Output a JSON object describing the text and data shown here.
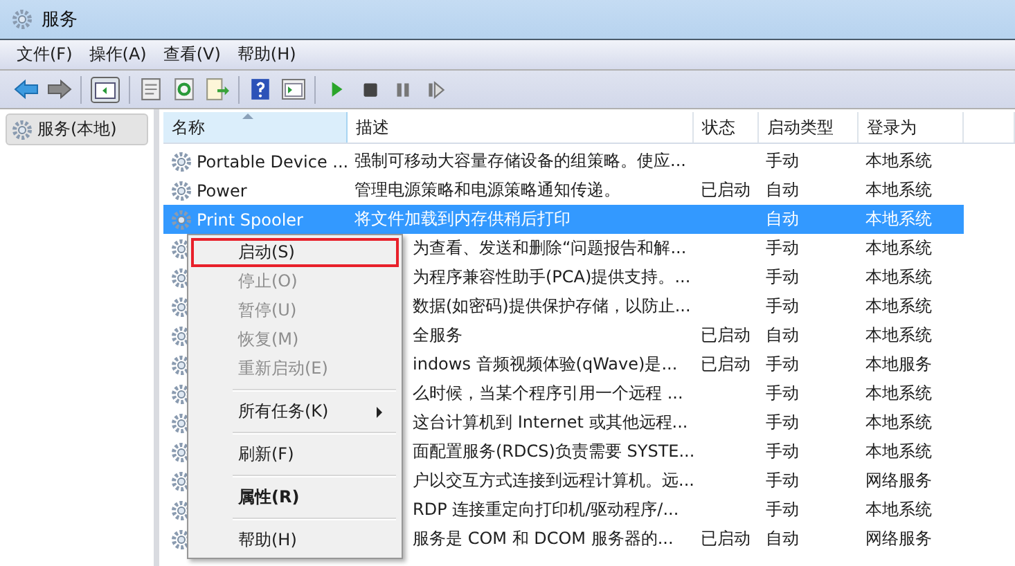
{
  "window": {
    "title": "服务"
  },
  "menu_bar": [
    "文件(F)",
    "操作(A)",
    "查看(V)",
    "帮助(H)"
  ],
  "tree": {
    "label": "服务(本地)",
    "selected": true
  },
  "table": {
    "columns": [
      "名称",
      "描述",
      "状态",
      "启动类型",
      "登录为"
    ],
    "rows": [
      {
        "kind": "full",
        "name": "Portable Device ...",
        "description": "强制可移动大容量存储设备的组策略。使应...",
        "status": "",
        "startup": "手动",
        "logon": "本地系统",
        "selected": false
      },
      {
        "kind": "full",
        "name": "Power",
        "description": "管理电源策略和电源策略通知传递。",
        "status": "已启动",
        "startup": "自动",
        "logon": "本地系统",
        "selected": false
      },
      {
        "kind": "full",
        "name": "Print Spooler",
        "description": "将文件加载到内存供稍后打印",
        "status": "",
        "startup": "自动",
        "logon": "本地系统",
        "selected": true
      },
      {
        "kind": "covered",
        "description": "为查看、发送和删除“问题报告和解...",
        "status": "",
        "startup": "手动",
        "logon": "本地系统",
        "selected": false
      },
      {
        "kind": "covered",
        "description": "为程序兼容性助手(PCA)提供支持。...",
        "status": "",
        "startup": "手动",
        "logon": "本地系统",
        "selected": false
      },
      {
        "kind": "covered",
        "description": "数据(如密码)提供保护存储，以防止...",
        "status": "",
        "startup": "手动",
        "logon": "本地系统",
        "selected": false
      },
      {
        "kind": "covered",
        "description": "全服务",
        "status": "已启动",
        "startup": "自动",
        "logon": "本地系统",
        "selected": false
      },
      {
        "kind": "covered",
        "description": "indows 音频视频体验(qWave)是...",
        "status": "已启动",
        "startup": "手动",
        "logon": "本地服务",
        "selected": false
      },
      {
        "kind": "covered",
        "description": "么时候，当某个程序引用一个远程 ...",
        "status": "",
        "startup": "手动",
        "logon": "本地系统",
        "selected": false
      },
      {
        "kind": "covered",
        "description": "这台计算机到 Internet 或其他远程...",
        "status": "",
        "startup": "手动",
        "logon": "本地系统",
        "selected": false
      },
      {
        "kind": "covered",
        "description": "面配置服务(RDCS)负责需要 SYSTE...",
        "status": "",
        "startup": "手动",
        "logon": "本地系统",
        "selected": false
      },
      {
        "kind": "covered",
        "description": "户以交互方式连接到远程计算机。远...",
        "status": "",
        "startup": "手动",
        "logon": "网络服务",
        "selected": false
      },
      {
        "kind": "covered",
        "description": "RDP 连接重定向打印机/驱动程序/...",
        "status": "",
        "startup": "手动",
        "logon": "本地系统",
        "selected": false
      },
      {
        "kind": "covered",
        "description": "服务是 COM 和 DCOM 服务器的...",
        "status": "已启动",
        "startup": "自动",
        "logon": "网络服务",
        "selected": false
      }
    ]
  },
  "context_menu": [
    {
      "kind": "item",
      "label": "启动(S)",
      "disabled": false,
      "bold": false,
      "submenu": false,
      "highlighted": true
    },
    {
      "kind": "item",
      "label": "停止(O)",
      "disabled": true,
      "bold": false,
      "submenu": false,
      "highlighted": false
    },
    {
      "kind": "item",
      "label": "暂停(U)",
      "disabled": true,
      "bold": false,
      "submenu": false,
      "highlighted": false
    },
    {
      "kind": "item",
      "label": "恢复(M)",
      "disabled": true,
      "bold": false,
      "submenu": false,
      "highlighted": false
    },
    {
      "kind": "item",
      "label": "重新启动(E)",
      "disabled": true,
      "bold": false,
      "submenu": false,
      "highlighted": false
    },
    {
      "kind": "separator"
    },
    {
      "kind": "item",
      "label": "所有任务(K)",
      "disabled": false,
      "bold": false,
      "submenu": true,
      "highlighted": false
    },
    {
      "kind": "separator"
    },
    {
      "kind": "item",
      "label": "刷新(F)",
      "disabled": false,
      "bold": false,
      "submenu": false,
      "highlighted": false
    },
    {
      "kind": "separator"
    },
    {
      "kind": "item",
      "label": "属性(R)",
      "disabled": false,
      "bold": true,
      "submenu": false,
      "highlighted": false
    },
    {
      "kind": "separator"
    },
    {
      "kind": "item",
      "label": "帮助(H)",
      "disabled": false,
      "bold": false,
      "submenu": false,
      "highlighted": false
    }
  ]
}
